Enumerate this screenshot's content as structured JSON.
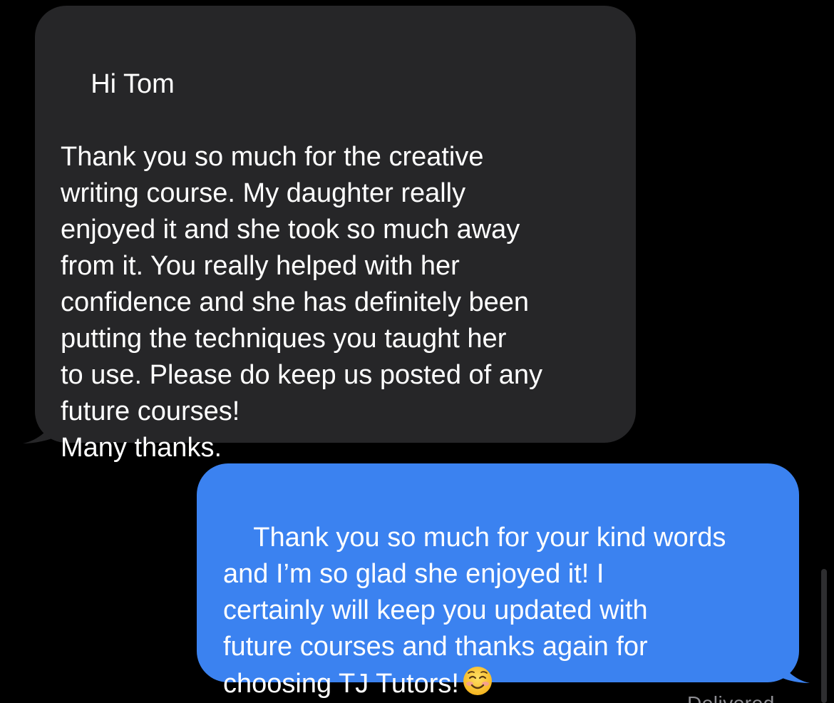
{
  "conversation": {
    "incoming_message": {
      "text": "Hi Tom\n\nThank you so much for the creative\nwriting course. My daughter really\nenjoyed it and she took so much away\nfrom it. You really helped with her\nconfidence and she has definitely been\nputting the techniques you taught her\nto use. Please do keep us posted of any\nfuture courses!\nMany thanks.",
      "bubble_color": "#262628"
    },
    "outgoing_message": {
      "text": "Thank you so much for your kind words\nand I’m so glad she enjoyed it! I\ncertainly will keep you updated with\nfuture courses and thanks again for\nchoosing TJ Tutors!",
      "emoji": "smiling-face-with-smiling-eyes",
      "bubble_color": "#3b82f0"
    },
    "status": "Delivered"
  },
  "colors": {
    "background": "#000000",
    "text": "#ffffff",
    "status_text": "#8e8e93"
  }
}
